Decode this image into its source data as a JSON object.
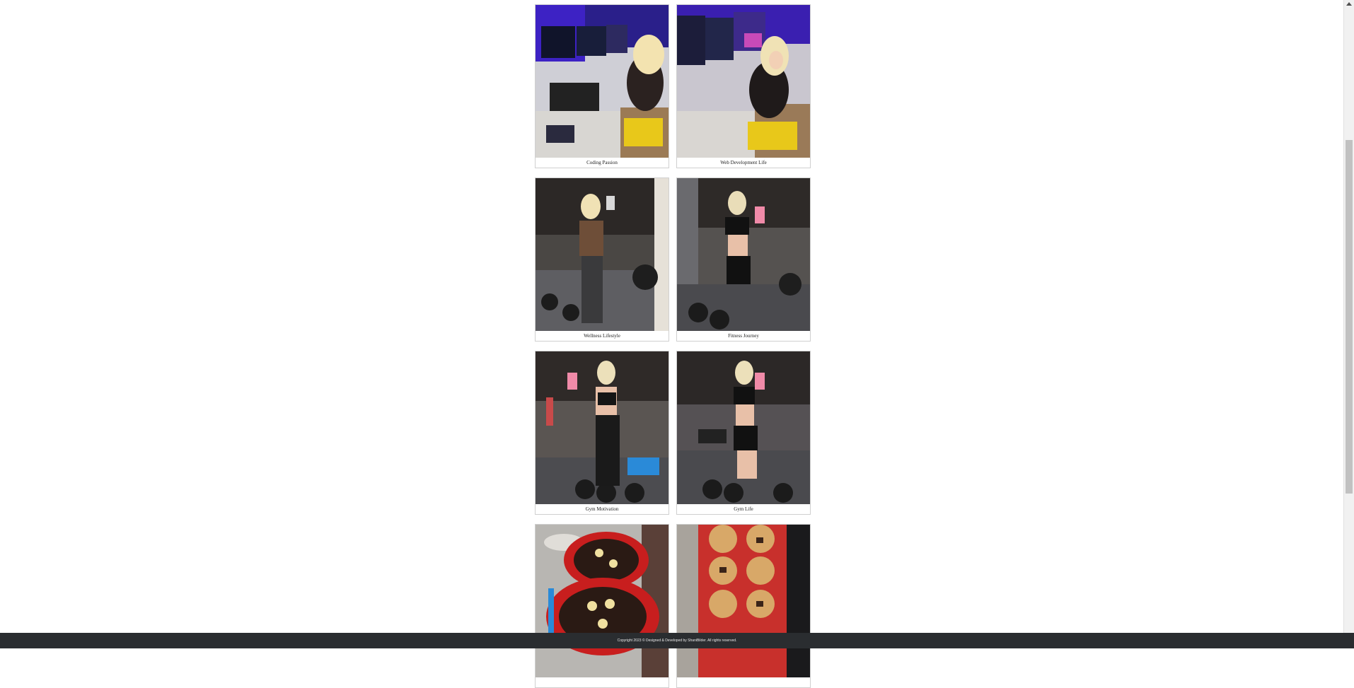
{
  "gallery": {
    "items": [
      {
        "caption": "Coding Passion",
        "scene": "coding-setup"
      },
      {
        "caption": "Web Development Life",
        "scene": "coding-setup-smile"
      },
      {
        "caption": "Wellness Lifestyle",
        "scene": "gym-brown-top"
      },
      {
        "caption": "Fitness Journey",
        "scene": "gym-black-set"
      },
      {
        "caption": "Gym Motivation",
        "scene": "gym-back-pose"
      },
      {
        "caption": "Gym Life",
        "scene": "gym-mirror-selfie"
      },
      {
        "caption": "",
        "scene": "banana-pancakes"
      },
      {
        "caption": "",
        "scene": "chocolate-chunk-muffins"
      }
    ]
  },
  "footer": {
    "text": "Copyright 2023 © Designed & Developed by ShaniBilder. All rights reserved."
  },
  "colors": {
    "footer_bg": "#2a2d30",
    "card_border": "#d0d0d0"
  }
}
